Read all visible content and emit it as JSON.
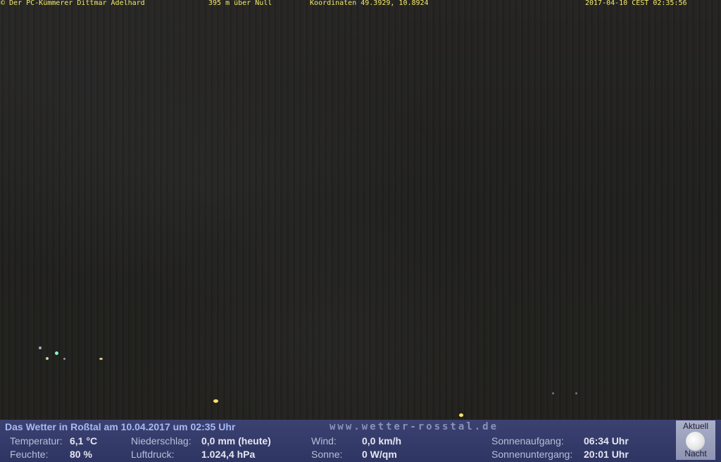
{
  "overlay": {
    "copyright": "© Der PC-Kümmerer Dittmar Adelhard",
    "altitude": "395 m über Null",
    "coordinates": "Koordinaten 49.3929, 10.8924",
    "timestamp": "2017-04-10 CEST 02:35:56"
  },
  "weather": {
    "title": "Das Wetter in Roßtal am 10.04.2017 um 02:35 Uhr",
    "url": "www.wetter-rosstal.de",
    "temperature_label": "Temperatur:",
    "temperature_value": "6,1 °C",
    "humidity_label": "Feuchte:",
    "humidity_value": "80 %",
    "precip_label": "Niederschlag:",
    "precip_value": "0,0 mm (heute)",
    "pressure_label": "Luftdruck:",
    "pressure_value": "1.024,4 hPa",
    "wind_label": "Wind:",
    "wind_value": "0,0 km/h",
    "sun_label": "Sonne:",
    "sun_value": "0 W/qm",
    "sunrise_label": "Sonnenaufgang:",
    "sunrise_value": "06:34 Uhr",
    "sunset_label": "Sonnenuntergang:",
    "sunset_value": "20:01 Uhr",
    "moon_top": "Aktuell",
    "moon_bottom": "Nacht"
  }
}
